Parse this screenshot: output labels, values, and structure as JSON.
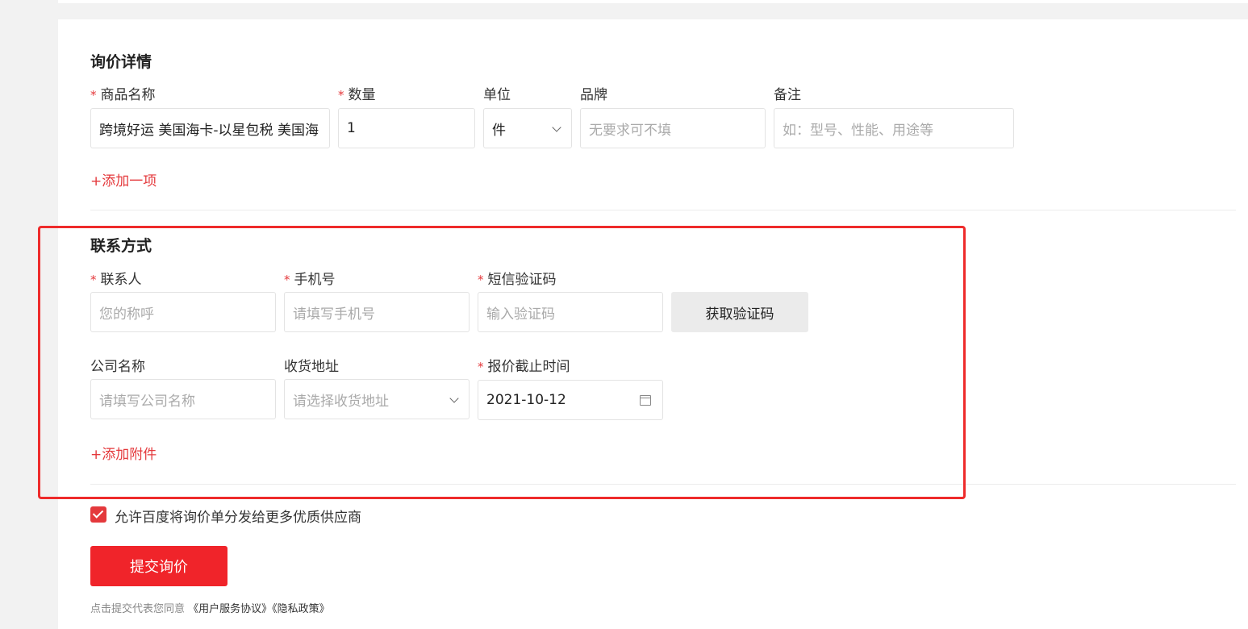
{
  "inquiry": {
    "title": "询价详情",
    "product_label": "商品名称",
    "product_value": "跨境好运 美国海卡-以星包税 美国海",
    "quantity_label": "数量",
    "quantity_value": "1",
    "unit_label": "单位",
    "unit_value": "件",
    "brand_label": "品牌",
    "brand_placeholder": "无要求可不填",
    "note_label": "备注",
    "note_placeholder": "如：型号、性能、用途等",
    "add_item": "+添加一项"
  },
  "contact": {
    "title": "联系方式",
    "name_label": "联系人",
    "name_placeholder": "您的称呼",
    "phone_label": "手机号",
    "phone_placeholder": "请填写手机号",
    "code_label": "短信验证码",
    "code_placeholder": "输入验证码",
    "get_code": "获取验证码",
    "company_label": "公司名称",
    "company_placeholder": "请填写公司名称",
    "address_label": "收货地址",
    "address_placeholder": "请选择收货地址",
    "deadline_label": "报价截止时间",
    "deadline_value": "2021-10-12",
    "add_attachment": "+添加附件"
  },
  "consent": {
    "checked": true,
    "text": "允许百度将询价单分发给更多优质供应商"
  },
  "submit_label": "提交询价",
  "agreement": {
    "prefix": "点击提交代表您同意",
    "terms": "《用户服务协议》",
    "privacy": "《隐私政策》"
  },
  "colors": {
    "accent": "#e4393c",
    "submit_bg": "#f0242a",
    "highlight_border": "#ee2b2b"
  },
  "required_mark": "*"
}
